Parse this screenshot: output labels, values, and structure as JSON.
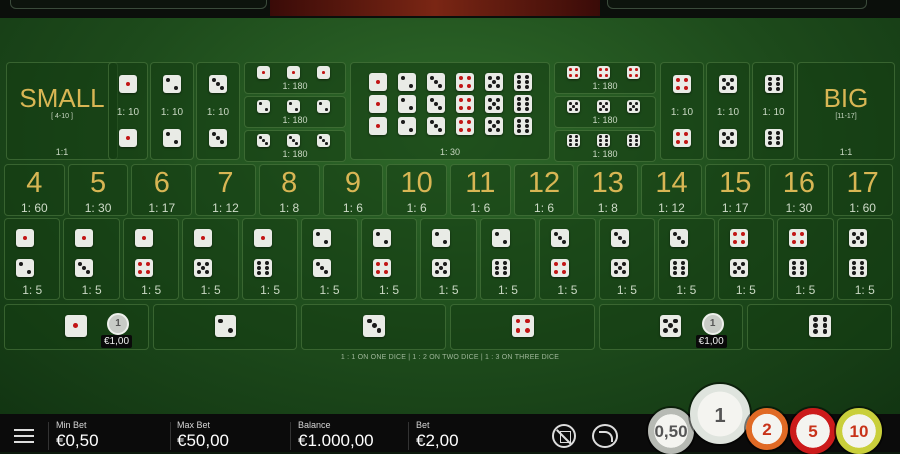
{
  "board": {
    "small": {
      "label": "SMALL",
      "range": "[ 4-10 ]",
      "odds": "1:1"
    },
    "big": {
      "label": "BIG",
      "range": "[11-17]",
      "odds": "1:1"
    },
    "doubles_odds": "1: 10",
    "triples_odds": "1: 180",
    "any_triple_odds": "1: 30",
    "totals": [
      {
        "n": "4",
        "odds": "1: 60"
      },
      {
        "n": "5",
        "odds": "1: 30"
      },
      {
        "n": "6",
        "odds": "1: 17"
      },
      {
        "n": "7",
        "odds": "1: 12"
      },
      {
        "n": "8",
        "odds": "1: 8"
      },
      {
        "n": "9",
        "odds": "1: 6"
      },
      {
        "n": "10",
        "odds": "1: 6"
      },
      {
        "n": "11",
        "odds": "1: 6"
      },
      {
        "n": "12",
        "odds": "1: 6"
      },
      {
        "n": "13",
        "odds": "1: 8"
      },
      {
        "n": "14",
        "odds": "1: 12"
      },
      {
        "n": "15",
        "odds": "1: 17"
      },
      {
        "n": "16",
        "odds": "1: 30"
      },
      {
        "n": "17",
        "odds": "1: 60"
      }
    ],
    "combos": [
      [
        1,
        2
      ],
      [
        1,
        3
      ],
      [
        1,
        4
      ],
      [
        1,
        5
      ],
      [
        1,
        6
      ],
      [
        2,
        3
      ],
      [
        2,
        4
      ],
      [
        2,
        5
      ],
      [
        2,
        6
      ],
      [
        3,
        4
      ],
      [
        3,
        5
      ],
      [
        3,
        6
      ],
      [
        4,
        5
      ],
      [
        4,
        6
      ],
      [
        5,
        6
      ]
    ],
    "combo_odds": "1: 5",
    "single_faces": [
      1,
      2,
      3,
      4,
      5,
      6
    ],
    "single_chip": {
      "value": "1",
      "amount": "€1,00"
    },
    "single_note": "1 : 1 ON ONE DICE | 1 : 2 ON TWO DICE | 1 : 3 ON THREE DICE"
  },
  "footer": {
    "menu_icon": "hamburger-menu-icon",
    "min_bet": {
      "label": "Min Bet",
      "value": "€0,50"
    },
    "max_bet": {
      "label": "Max Bet",
      "value": "€50,00"
    },
    "balance": {
      "label": "Balance",
      "value": "€1.000,00"
    },
    "bet": {
      "label": "Bet",
      "value": "€2,00"
    },
    "action_icons": [
      "clear-bets-icon",
      "undo-icon"
    ],
    "chips": [
      {
        "value": "0,50",
        "color": "#b7bab4"
      },
      {
        "value": "1",
        "color": "#dfe4de"
      },
      {
        "value": "2",
        "color": "#e06a25"
      },
      {
        "value": "5",
        "color": "#cc1b1b"
      },
      {
        "value": "10",
        "color": "#c9cf3b"
      }
    ]
  },
  "colors": {
    "felt": "#1d4a1b",
    "gold_text": "#d8b654",
    "red_pip": "#c21515"
  }
}
